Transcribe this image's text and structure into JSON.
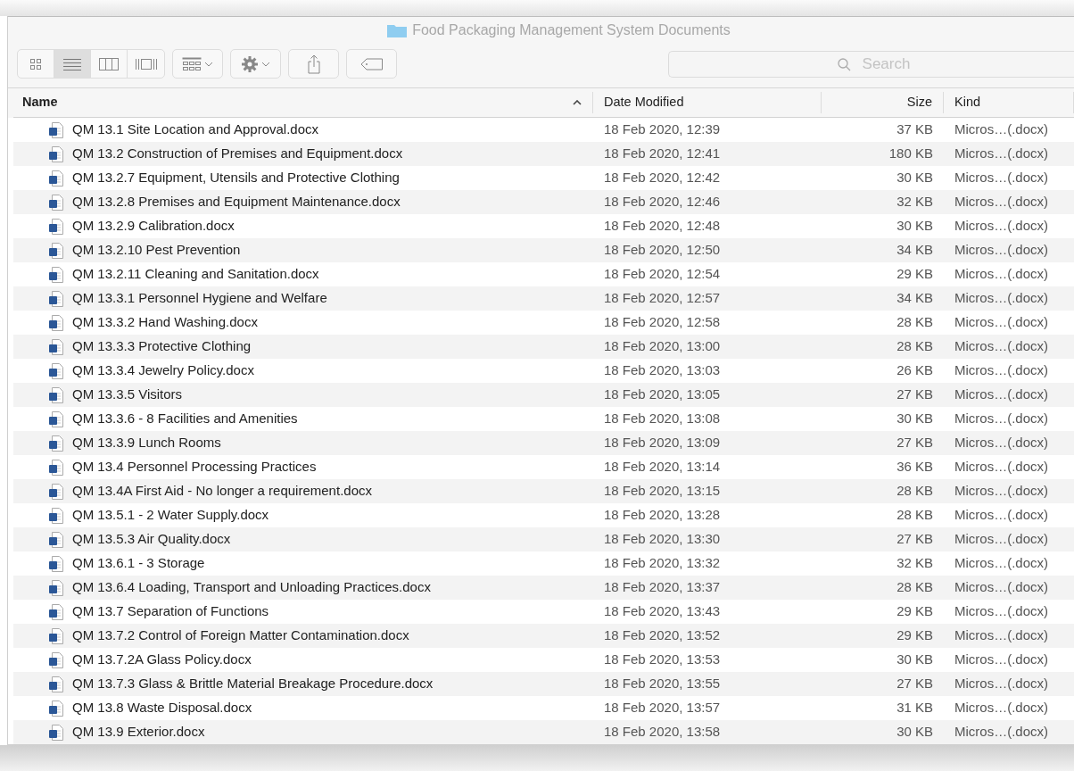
{
  "window": {
    "title": "Food Packaging Management System Documents"
  },
  "toolbar": {
    "view_modes": [
      {
        "kind": "icons",
        "selected": false
      },
      {
        "kind": "list",
        "selected": true
      },
      {
        "kind": "columns",
        "selected": false
      },
      {
        "kind": "gallery",
        "selected": false
      }
    ],
    "search": {
      "placeholder": "Search"
    }
  },
  "table": {
    "columns": [
      {
        "label": "Name",
        "sorted": true
      },
      {
        "label": "Date Modified",
        "sorted": false
      },
      {
        "label": "Size",
        "sorted": false
      },
      {
        "label": "Kind",
        "sorted": false
      }
    ],
    "rows": [
      {
        "name": "QM 13.1 Site Location and Approval.docx",
        "date": "18 Feb 2020, 12:39",
        "size": "37 KB",
        "kind": "Micros…(.docx)"
      },
      {
        "name": "QM 13.2 Construction of Premises and Equipment.docx",
        "date": "18 Feb 2020, 12:41",
        "size": "180 KB",
        "kind": "Micros…(.docx)"
      },
      {
        "name": "QM 13.2.7 Equipment, Utensils and Protective Clothing",
        "date": "18 Feb 2020, 12:42",
        "size": "30 KB",
        "kind": "Micros…(.docx)"
      },
      {
        "name": "QM 13.2.8 Premises and Equipment Maintenance.docx",
        "date": "18 Feb 2020, 12:46",
        "size": "32 KB",
        "kind": "Micros…(.docx)"
      },
      {
        "name": "QM 13.2.9 Calibration.docx",
        "date": "18 Feb 2020, 12:48",
        "size": "30 KB",
        "kind": "Micros…(.docx)"
      },
      {
        "name": "QM 13.2.10 Pest Prevention",
        "date": "18 Feb 2020, 12:50",
        "size": "34 KB",
        "kind": "Micros…(.docx)"
      },
      {
        "name": "QM 13.2.11 Cleaning and Sanitation.docx",
        "date": "18 Feb 2020, 12:54",
        "size": "29 KB",
        "kind": "Micros…(.docx)"
      },
      {
        "name": "QM 13.3.1 Personnel Hygiene and Welfare",
        "date": "18 Feb 2020, 12:57",
        "size": "34 KB",
        "kind": "Micros…(.docx)"
      },
      {
        "name": "QM 13.3.2 Hand Washing.docx",
        "date": "18 Feb 2020, 12:58",
        "size": "28 KB",
        "kind": "Micros…(.docx)"
      },
      {
        "name": "QM 13.3.3 Protective Clothing",
        "date": "18 Feb 2020, 13:00",
        "size": "28 KB",
        "kind": "Micros…(.docx)"
      },
      {
        "name": "QM 13.3.4 Jewelry Policy.docx",
        "date": "18 Feb 2020, 13:03",
        "size": "26 KB",
        "kind": "Micros…(.docx)"
      },
      {
        "name": "QM 13.3.5 Visitors",
        "date": "18 Feb 2020, 13:05",
        "size": "27 KB",
        "kind": "Micros…(.docx)"
      },
      {
        "name": "QM 13.3.6 - 8 Facilities and Amenities",
        "date": "18 Feb 2020, 13:08",
        "size": "30 KB",
        "kind": "Micros…(.docx)"
      },
      {
        "name": "QM 13.3.9 Lunch Rooms",
        "date": "18 Feb 2020, 13:09",
        "size": "27 KB",
        "kind": "Micros…(.docx)"
      },
      {
        "name": "QM 13.4 Personnel Processing Practices",
        "date": "18 Feb 2020, 13:14",
        "size": "36 KB",
        "kind": "Micros…(.docx)"
      },
      {
        "name": "QM 13.4A First Aid - No longer a requirement.docx",
        "date": "18 Feb 2020, 13:15",
        "size": "28 KB",
        "kind": "Micros…(.docx)"
      },
      {
        "name": "QM 13.5.1 - 2 Water Supply.docx",
        "date": "18 Feb 2020, 13:28",
        "size": "28 KB",
        "kind": "Micros…(.docx)"
      },
      {
        "name": "QM 13.5.3 Air Quality.docx",
        "date": "18 Feb 2020, 13:30",
        "size": "27 KB",
        "kind": "Micros…(.docx)"
      },
      {
        "name": "QM 13.6.1 - 3 Storage",
        "date": "18 Feb 2020, 13:32",
        "size": "32 KB",
        "kind": "Micros…(.docx)"
      },
      {
        "name": "QM 13.6.4 Loading, Transport and Unloading Practices.docx",
        "date": "18 Feb 2020, 13:37",
        "size": "28 KB",
        "kind": "Micros…(.docx)"
      },
      {
        "name": "QM 13.7 Separation of Functions",
        "date": "18 Feb 2020, 13:43",
        "size": "29 KB",
        "kind": "Micros…(.docx)"
      },
      {
        "name": "QM 13.7.2 Control of Foreign Matter Contamination.docx",
        "date": "18 Feb 2020, 13:52",
        "size": "29 KB",
        "kind": "Micros…(.docx)"
      },
      {
        "name": "QM 13.7.2A Glass Policy.docx",
        "date": "18 Feb 2020, 13:53",
        "size": "30 KB",
        "kind": "Micros…(.docx)"
      },
      {
        "name": "QM 13.7.3 Glass & Brittle Material Breakage Procedure.docx",
        "date": "18 Feb 2020, 13:55",
        "size": "27 KB",
        "kind": "Micros…(.docx)"
      },
      {
        "name": "QM 13.8 Waste Disposal.docx",
        "date": "18 Feb 2020, 13:57",
        "size": "31 KB",
        "kind": "Micros…(.docx)"
      },
      {
        "name": "QM 13.9 Exterior.docx",
        "date": "18 Feb 2020, 13:58",
        "size": "30 KB",
        "kind": "Micros…(.docx)"
      }
    ]
  }
}
